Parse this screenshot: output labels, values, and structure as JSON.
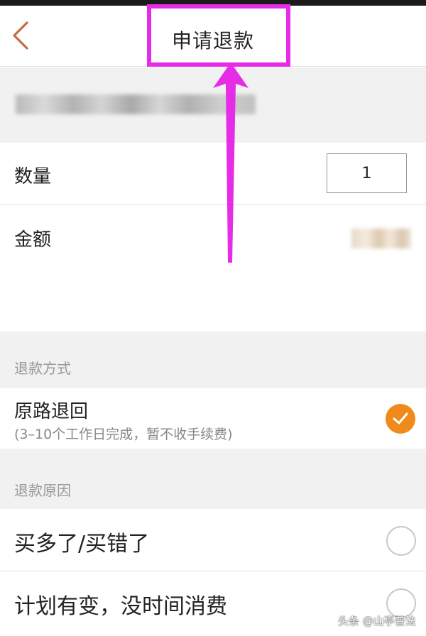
{
  "header": {
    "title": "申请退款",
    "back_icon": "chevron-left-icon"
  },
  "quantity": {
    "label": "数量",
    "value": "1"
  },
  "amount": {
    "label": "金额"
  },
  "refund_method": {
    "section_label": "退款方式",
    "option_title": "原路退回",
    "option_subtitle": "(3–10个工作日完成，暂不收手续费)",
    "selected": true
  },
  "refund_reason": {
    "section_label": "退款原因",
    "options": [
      {
        "label": "买多了/买错了",
        "selected": false
      },
      {
        "label": "计划有变，没时间消费",
        "selected": false
      }
    ]
  },
  "watermark": {
    "text": "头条 @山亭普法"
  },
  "colors": {
    "accent": "#f08a1a",
    "highlight": "#e62ce6",
    "back": "#c96a3e"
  }
}
